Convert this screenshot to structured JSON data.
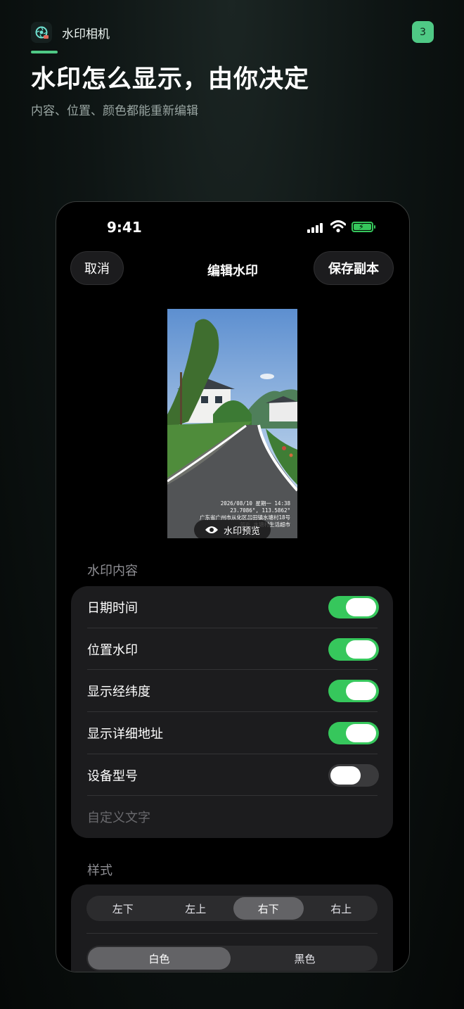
{
  "header": {
    "app_name": "水印相机",
    "badge": "3",
    "headline": "水印怎么显示，由你决定",
    "subline": "内容、位置、颜色都能重新编辑"
  },
  "phone": {
    "status": {
      "time": "9:41"
    },
    "nav": {
      "cancel": "取消",
      "title": "编辑水印",
      "save": "保存副本"
    },
    "preview": {
      "watermark_lines": [
        "2026/08/10  星期一  14:38",
        "23.7086°, 113.5862°",
        "广东省广州市从化区吕田镇水塘村18号",
        "邻近 水塘村生活超市"
      ],
      "chip_label": "水印预览"
    },
    "content_section": {
      "title": "水印内容",
      "rows": [
        {
          "label": "日期时间",
          "on": true
        },
        {
          "label": "位置水印",
          "on": true
        },
        {
          "label": "显示经纬度",
          "on": true
        },
        {
          "label": "显示详细地址",
          "on": true
        },
        {
          "label": "设备型号",
          "on": false
        }
      ],
      "custom_text_placeholder": "自定义文字"
    },
    "style_section": {
      "title": "样式",
      "positions": [
        "左下",
        "左上",
        "右下",
        "右上"
      ],
      "selected_position": "右下",
      "colors": [
        "白色",
        "黑色"
      ],
      "selected_color": "白色"
    }
  },
  "colors": {
    "accent": "#4fc985",
    "toggle_on": "#36c75c",
    "card": "#1c1c1e"
  }
}
